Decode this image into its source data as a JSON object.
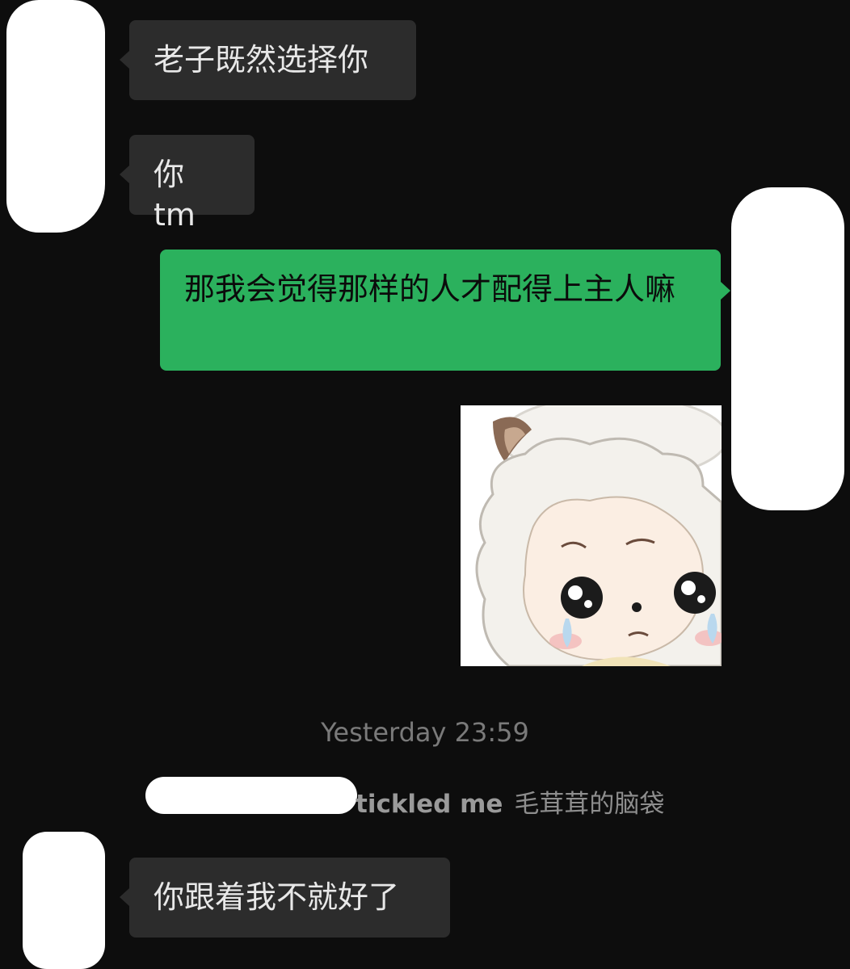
{
  "messages": [
    {
      "side": "incoming",
      "text": "老子既然选择你"
    },
    {
      "side": "incoming",
      "text": "你 tm"
    },
    {
      "side": "outgoing",
      "text": "那我会觉得那样的人才配得上主人嘛"
    },
    {
      "side": "outgoing",
      "sticker": "crying-sheep-sticker"
    },
    {
      "side": "incoming",
      "text": "你跟着我不就好了"
    }
  ],
  "timestamp": "Yesterday 23:59",
  "system_notice": {
    "action": "tickled me",
    "suffix": "毛茸茸的脑袋"
  },
  "colors": {
    "background": "#0d0d0d",
    "incoming_bubble": "#2c2c2c",
    "outgoing_bubble": "#2bb15d",
    "redaction": "#ffffff"
  }
}
